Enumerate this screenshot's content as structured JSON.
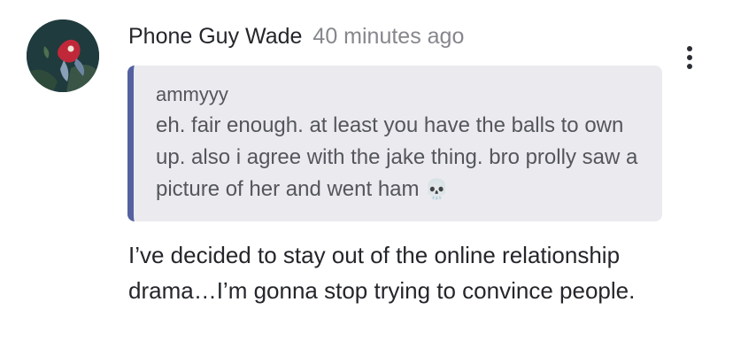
{
  "comment": {
    "author": "Phone Guy Wade",
    "timestamp": "40 minutes ago",
    "quote": {
      "author": "ammyyy",
      "text": "eh. fair enough. at least you have the balls to own up. also i agree with the jake thing. bro prolly saw a picture of her and went ham",
      "emoji": "💀"
    },
    "body": "I’ve decided to stay out of the online relationship drama…I’m gonna stop trying to convince people."
  },
  "icons": {
    "more": "more-options-icon",
    "avatar": "avatar-image"
  },
  "colors": {
    "quote_bar": "#5461a0",
    "quote_bg": "#ebebef",
    "author_text": "#24262b",
    "muted_text": "#85878d"
  }
}
